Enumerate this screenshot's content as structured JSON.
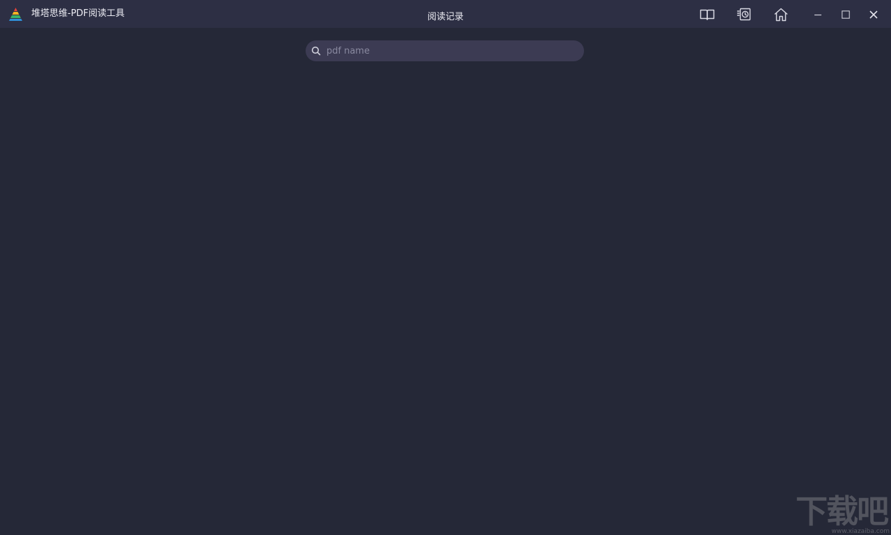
{
  "app": {
    "title": "堆塔思维-PDF阅读工具",
    "page_title": "阅读记录",
    "logo_icon": "pyramid-logo-icon"
  },
  "toolbar": {
    "buttons": [
      {
        "name": "book-icon",
        "label": "book"
      },
      {
        "name": "history-icon",
        "label": "reading history"
      },
      {
        "name": "home-icon",
        "label": "home"
      }
    ]
  },
  "window_controls": {
    "minimize_icon": "minimize-icon",
    "maximize_icon": "maximize-icon",
    "close_icon": "close-icon"
  },
  "search": {
    "placeholder": "pdf name",
    "value": ""
  },
  "watermark": {
    "text": "下载吧",
    "url": "www.xiazaiba.com"
  },
  "colors": {
    "background": "#252837",
    "titlebar": "#2d2f44",
    "search_bg": "#3c3b53",
    "text": "#ececf3",
    "placeholder": "#8a8aa0"
  }
}
